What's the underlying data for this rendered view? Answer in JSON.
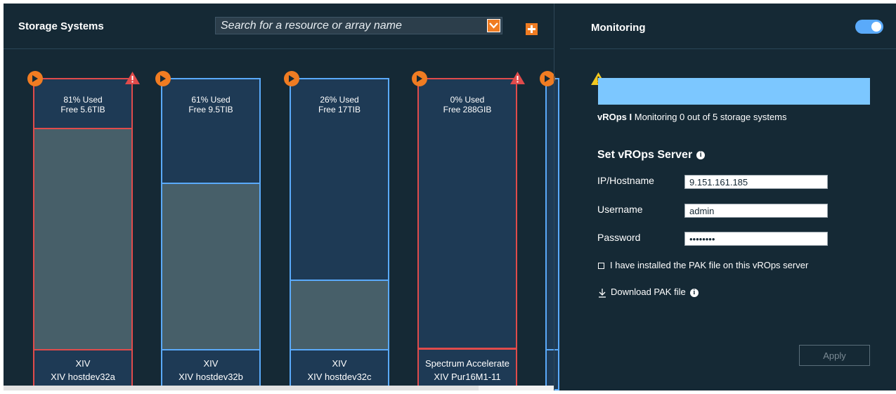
{
  "left": {
    "title": "Storage Systems",
    "search_placeholder": "Search for a resource or array name"
  },
  "systems": [
    {
      "used": "81% Used",
      "free": "Free 5.6TIB",
      "type": "XIV",
      "name": "XIV hostdev32a",
      "used_fraction": 0.81,
      "warning": true
    },
    {
      "used": "61% Used",
      "free": "Free 9.5TIB",
      "type": "XIV",
      "name": "XIV hostdev32b",
      "used_fraction": 0.61,
      "warning": false
    },
    {
      "used": "26% Used",
      "free": "Free 17TIB",
      "type": "XIV",
      "name": "XIV hostdev32c",
      "used_fraction": 0.26,
      "warning": false
    },
    {
      "used": "0% Used",
      "free": "Free 288GIB",
      "type": "Spectrum Accelerate",
      "name": "XIV Pur16M1-11",
      "used_fraction": 0.0,
      "warning": true
    }
  ],
  "monitoring": {
    "title": "Monitoring",
    "toggle_on": true,
    "status_bold": "vROps I",
    "status_text": " Monitoring 0 out of 5 storage systems",
    "section": "Set vROps Server",
    "ip_label": "IP/Hostname",
    "ip_value": "9.151.161.185",
    "user_label": "Username",
    "user_value": "admin",
    "pass_label": "Password",
    "pass_value": "••••••••",
    "checkbox_label": "I have installed the PAK file on this vROps server",
    "download_label": "Download PAK file",
    "apply_label": "Apply"
  },
  "colors": {
    "bg": "#152935",
    "accent_orange": "#f07c22",
    "warn_red": "#e04b4b",
    "ok_blue": "#5aaafa",
    "used_fill": "#475f69"
  }
}
